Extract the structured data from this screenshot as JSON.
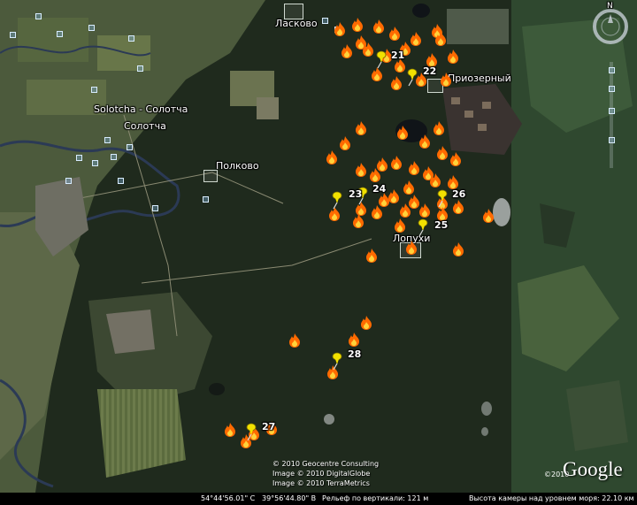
{
  "places": {
    "laskovo": "Ласково",
    "solotcha_latin": "Solotcha - Солотча",
    "solotcha": "Солотча",
    "polkovo": "Полково",
    "priozerny": "Приозерный",
    "lopukhi": "Лопухи"
  },
  "markers": [
    "21",
    "22",
    "23",
    "24",
    "25",
    "26",
    "27",
    "28"
  ],
  "copyright": {
    "line1": "© 2010 Geocentre Consulting",
    "line2": "Image © 2010 DigitalGlobe",
    "line3": "Image © 2010 TerraMetrics"
  },
  "status": {
    "lat": "54°44'56.01\" С",
    "lon": "39°56'44.80\" В",
    "relief": "Рельеф по вертикали:  121 м",
    "altitude": "Высота камеры над уровнем моря:  22.10 км"
  },
  "logo": {
    "text": "Google",
    "year": "©2010"
  },
  "compass": {
    "north": "N"
  },
  "icons": {
    "fire": "fire-icon",
    "pushpin": "yellow-pushpin-icon",
    "settlement": "square-settlement-icon"
  },
  "colors": {
    "fire": "#ff6a00",
    "pin": "#f2e100",
    "forest": "#1e2a1c"
  }
}
